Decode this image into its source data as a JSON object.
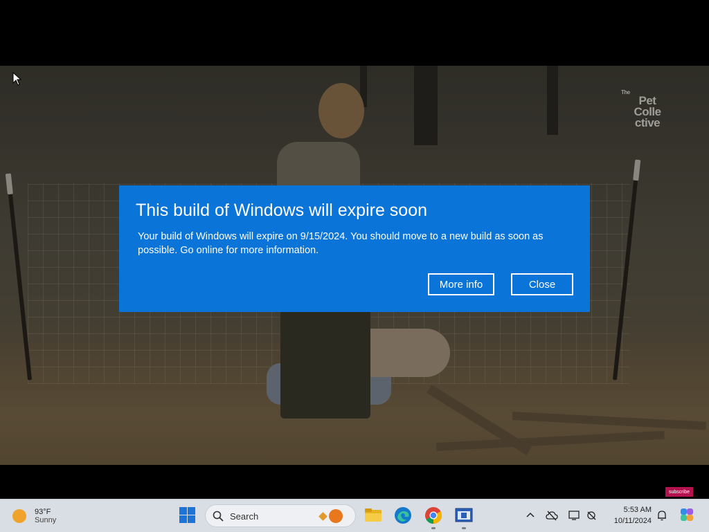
{
  "dialog": {
    "title": "This build of Windows will expire soon",
    "message": "Your build of Windows will expire on 9/15/2024. You should move to a new build as soon as possible. Go online for more information.",
    "more_info_label": "More info",
    "close_label": "Close",
    "background_color": "#0a74d8"
  },
  "video": {
    "watermark_small": "The",
    "watermark_line1": "Pet",
    "watermark_line2": "Colle",
    "watermark_line3": "ctive",
    "subscribe_label": "subscribe"
  },
  "taskbar": {
    "weather": {
      "temp": "93°F",
      "condition": "Sunny",
      "icon": "sun-icon"
    },
    "search": {
      "label": "Search"
    },
    "clock": {
      "time": "5:53 AM",
      "date": "10/11/2024"
    },
    "apps": [
      "start-icon",
      "file-explorer-icon",
      "edge-icon",
      "chrome-icon",
      "app-window-icon"
    ],
    "tray": [
      "chevron-up-icon",
      "onedrive-icon",
      "display-icon",
      "network-icon",
      "notification-icon",
      "copilot-icon"
    ]
  }
}
